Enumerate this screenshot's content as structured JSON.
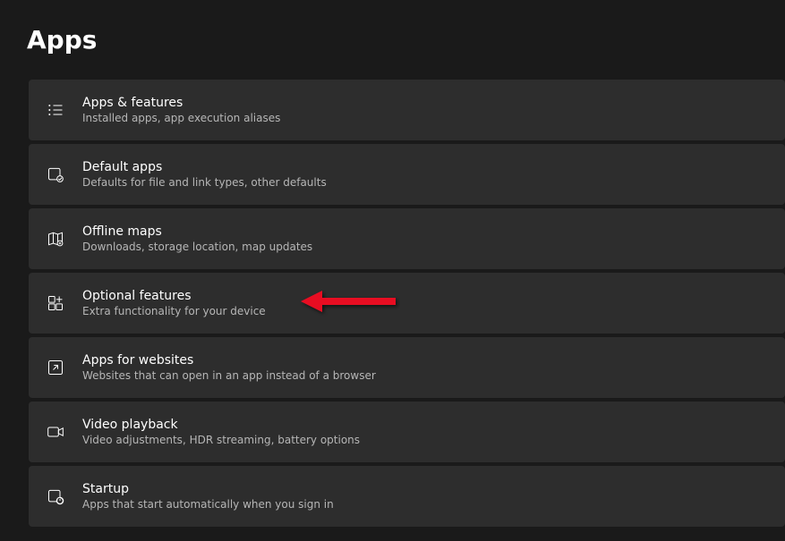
{
  "page": {
    "title": "Apps"
  },
  "items": [
    {
      "title": "Apps & features",
      "desc": "Installed apps, app execution aliases"
    },
    {
      "title": "Default apps",
      "desc": "Defaults for file and link types, other defaults"
    },
    {
      "title": "Offline maps",
      "desc": "Downloads, storage location, map updates"
    },
    {
      "title": "Optional features",
      "desc": "Extra functionality for your device"
    },
    {
      "title": "Apps for websites",
      "desc": "Websites that can open in an app instead of a browser"
    },
    {
      "title": "Video playback",
      "desc": "Video adjustments, HDR streaming, battery options"
    },
    {
      "title": "Startup",
      "desc": "Apps that start automatically when you sign in"
    }
  ]
}
